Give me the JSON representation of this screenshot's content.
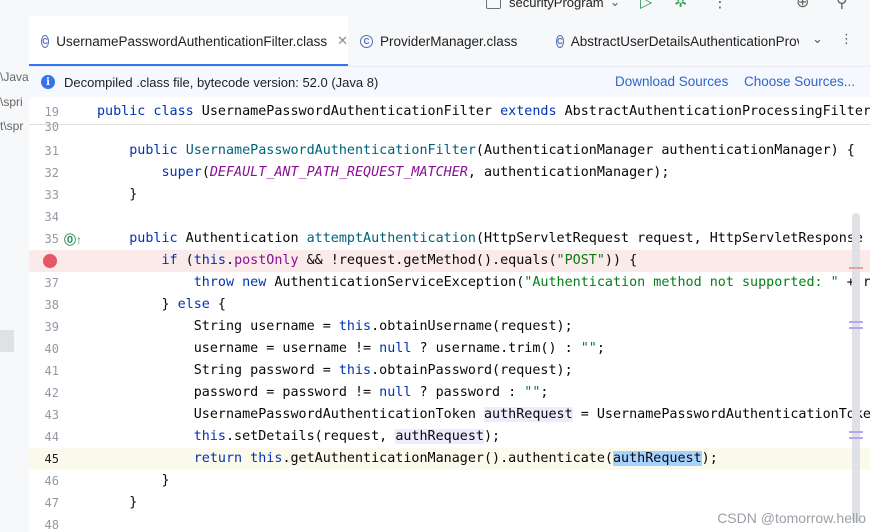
{
  "toolbar": {
    "run_config": "securityProgram"
  },
  "sidebar": {
    "fragments": [
      "\\Java",
      "\\spri",
      "t\\spr"
    ]
  },
  "tabs": [
    {
      "label": "UsernamePasswordAuthenticationFilter.class",
      "active": true
    },
    {
      "label": "ProviderManager.class",
      "active": false
    },
    {
      "label": "AbstractUserDetailsAuthenticationProv",
      "active": false
    }
  ],
  "infobar": {
    "message": "Decompiled .class file, bytecode version: 52.0 (Java 8)",
    "download_label": "Download Sources",
    "choose_label": "Choose Sources..."
  },
  "editor": {
    "lines": [
      {
        "num": "19",
        "text": "public class UsernamePasswordAuthenticationFilter extends AbstractAuthenticationProcessingFilter"
      },
      {
        "num": "30",
        "text": ""
      },
      {
        "num": "31",
        "text": "    public UsernamePasswordAuthenticationFilter(AuthenticationManager authenticationManager) {"
      },
      {
        "num": "32",
        "text": "        super(DEFAULT_ANT_PATH_REQUEST_MATCHER, authenticationManager);"
      },
      {
        "num": "33",
        "text": "    }"
      },
      {
        "num": "34",
        "text": ""
      },
      {
        "num": "35",
        "text": "    public Authentication attemptAuthentication(HttpServletRequest request, HttpServletResponse re"
      },
      {
        "num": "",
        "text": "        if (this.postOnly && !request.getMethod().equals(\"POST\")) {"
      },
      {
        "num": "37",
        "text": "            throw new AuthenticationServiceException(\"Authentication method not supported: \" + req"
      },
      {
        "num": "38",
        "text": "        } else {"
      },
      {
        "num": "39",
        "text": "            String username = this.obtainUsername(request);"
      },
      {
        "num": "40",
        "text": "            username = username != null ? username.trim() : \"\";"
      },
      {
        "num": "41",
        "text": "            String password = this.obtainPassword(request);"
      },
      {
        "num": "42",
        "text": "            password = password != null ? password : \"\";"
      },
      {
        "num": "43",
        "text": "            UsernamePasswordAuthenticationToken authRequest = UsernamePasswordAuthenticationToken."
      },
      {
        "num": "44",
        "text": "            this.setDetails(request, authRequest);"
      },
      {
        "num": "45",
        "text": "            return this.getAuthenticationManager().authenticate(authRequest);"
      },
      {
        "num": "46",
        "text": "        }"
      },
      {
        "num": "47",
        "text": "    }"
      },
      {
        "num": "48",
        "text": ""
      }
    ]
  },
  "watermark": "CSDN @tomorrow.hello",
  "colors": {
    "accent": "#3574f0",
    "breakpoint": "#e55765",
    "keyword": "#0033b3",
    "string": "#067d17",
    "field": "#871094",
    "method": "#00627a"
  }
}
